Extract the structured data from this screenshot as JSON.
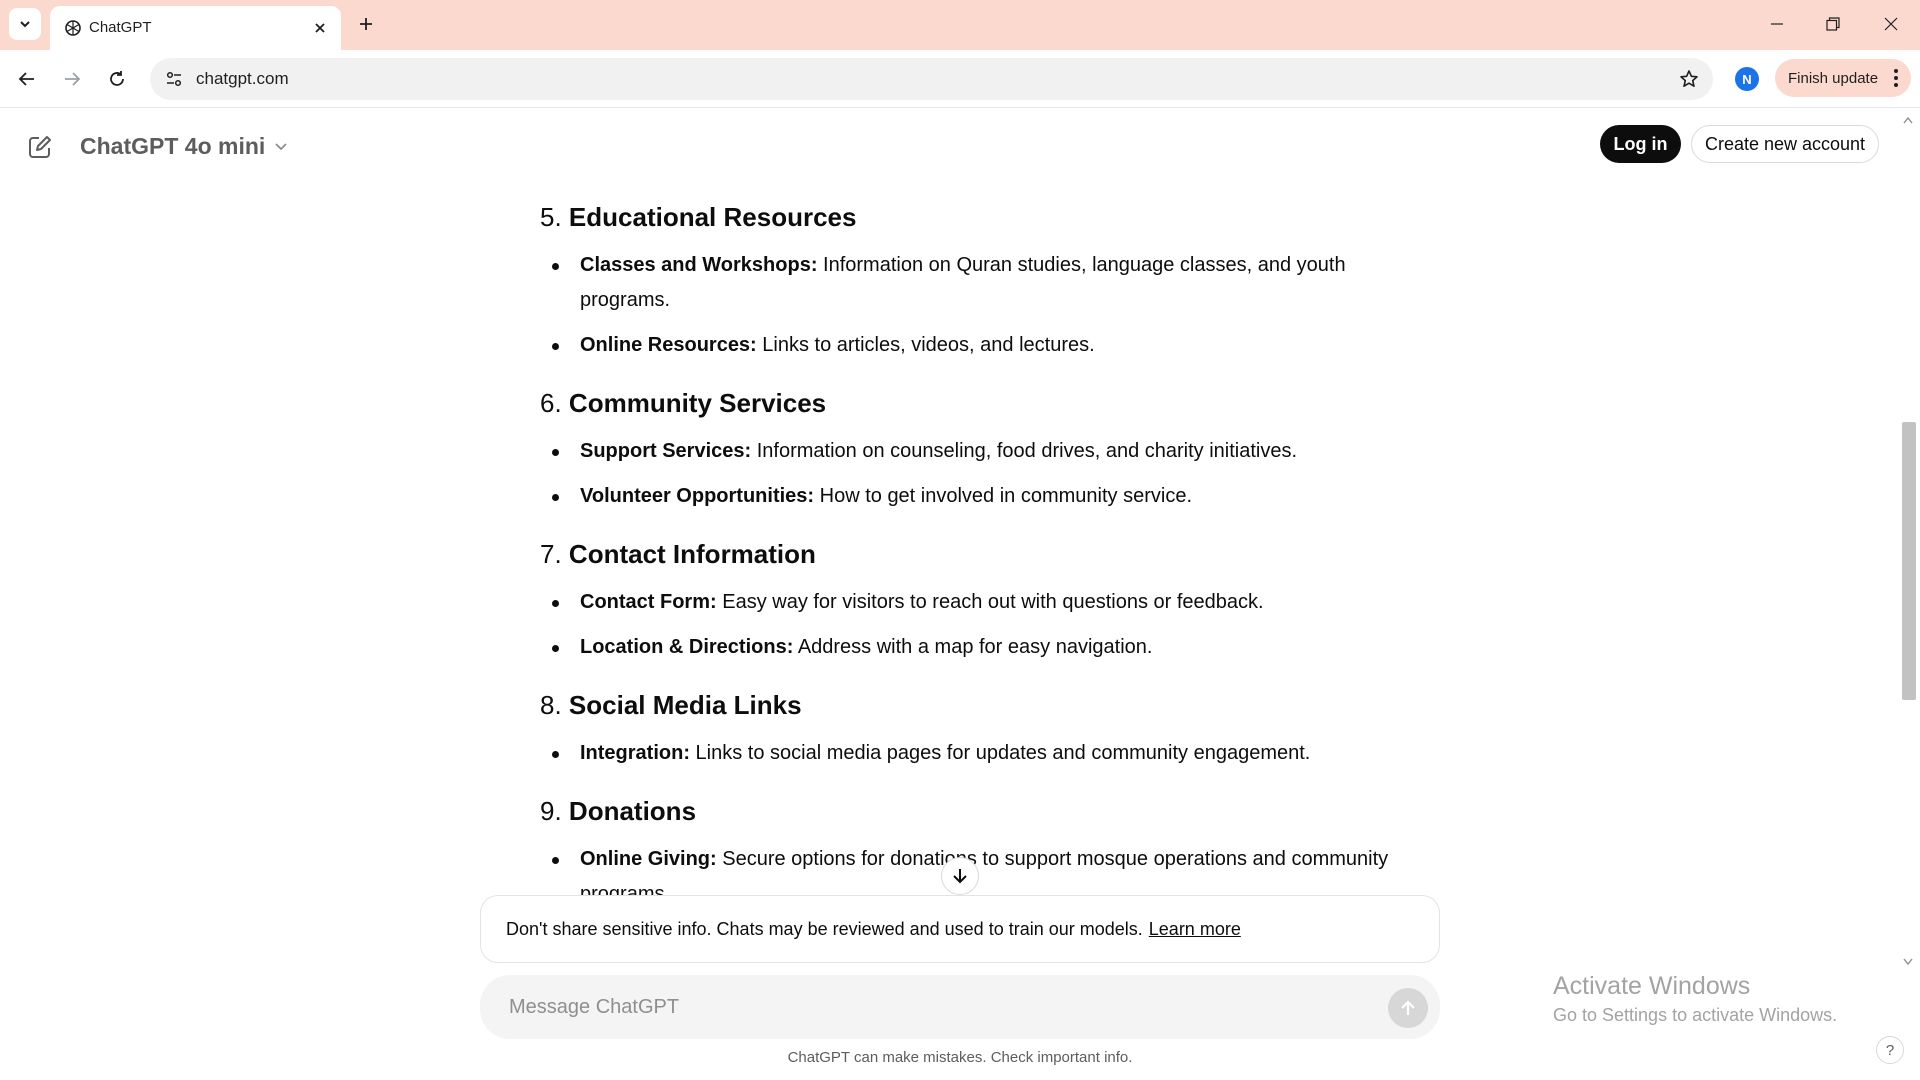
{
  "browser": {
    "tab_title": "ChatGPT",
    "url": "chatgpt.com",
    "profile_initial": "N",
    "finish_update_label": "Finish update"
  },
  "header": {
    "model_name": "ChatGPT 4o mini",
    "login_label": "Log in",
    "signup_label": "Create new account"
  },
  "sections": [
    {
      "number": "5.",
      "title": "Educational Resources",
      "bullets": [
        {
          "term": "Classes and Workshops:",
          "text": " Information on Quran studies, language classes, and youth programs."
        },
        {
          "term": "Online Resources:",
          "text": " Links to articles, videos, and lectures."
        }
      ]
    },
    {
      "number": "6.",
      "title": "Community Services",
      "bullets": [
        {
          "term": "Support Services:",
          "text": " Information on counseling, food drives, and charity initiatives."
        },
        {
          "term": "Volunteer Opportunities:",
          "text": " How to get involved in community service."
        }
      ]
    },
    {
      "number": "7.",
      "title": "Contact Information",
      "bullets": [
        {
          "term": "Contact Form:",
          "text": " Easy way for visitors to reach out with questions or feedback."
        },
        {
          "term": "Location & Directions:",
          "text": " Address with a map for easy navigation."
        }
      ]
    },
    {
      "number": "8.",
      "title": "Social Media Links",
      "bullets": [
        {
          "term": "Integration:",
          "text": " Links to social media pages for updates and community engagement."
        }
      ]
    },
    {
      "number": "9.",
      "title": "Donations",
      "bullets": [
        {
          "term": "Online Giving:",
          "text": " Secure options for donations to support mosque operations and community programs."
        }
      ]
    }
  ],
  "notice": {
    "text": "Don't share sensitive info. Chats may be reviewed and used to train our models.",
    "link": "Learn more"
  },
  "composer": {
    "placeholder": "Message ChatGPT"
  },
  "disclaimer": "ChatGPT can make mistakes. Check important info.",
  "watermark": {
    "title": "Activate Windows",
    "subtitle": "Go to Settings to activate Windows."
  },
  "help_label": "?",
  "colors": {
    "tabstrip": "#fcd9cf",
    "login_bg": "#0d0d0d",
    "profile": "#1a73e8"
  }
}
